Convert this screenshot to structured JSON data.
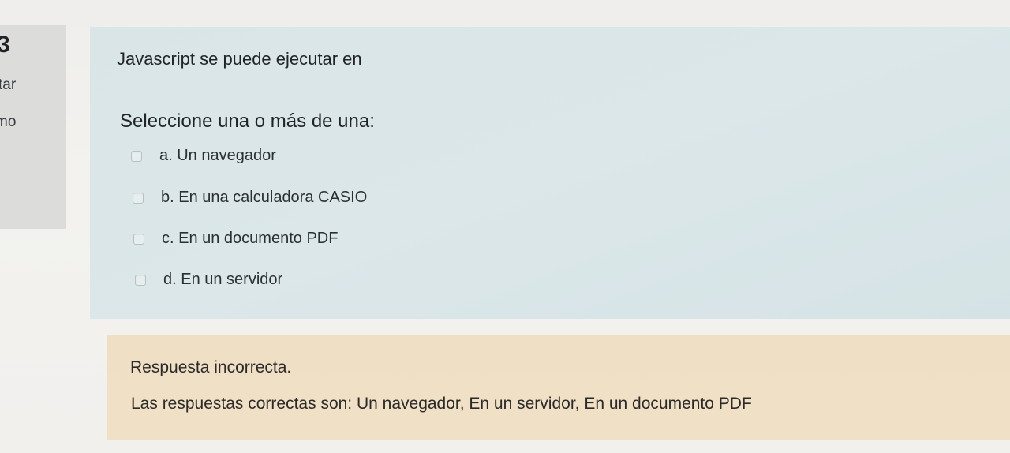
{
  "info": {
    "number": "3",
    "state": "tar",
    "grade": "mo"
  },
  "question": {
    "text": "Javascript se puede ejecutar en",
    "prompt": "Seleccione una o más de una:",
    "options": [
      {
        "label": "a. Un navegador",
        "checked": false
      },
      {
        "label": "b. En una calculadora CASIO",
        "checked": false
      },
      {
        "label": "c. En un documento PDF",
        "checked": false
      },
      {
        "label": "d. En un servidor",
        "checked": false
      }
    ]
  },
  "feedback": {
    "result": "Respuesta incorrecta.",
    "correct_answers": "Las respuestas correctas son: Un navegador, En un servidor, En un documento PDF"
  }
}
